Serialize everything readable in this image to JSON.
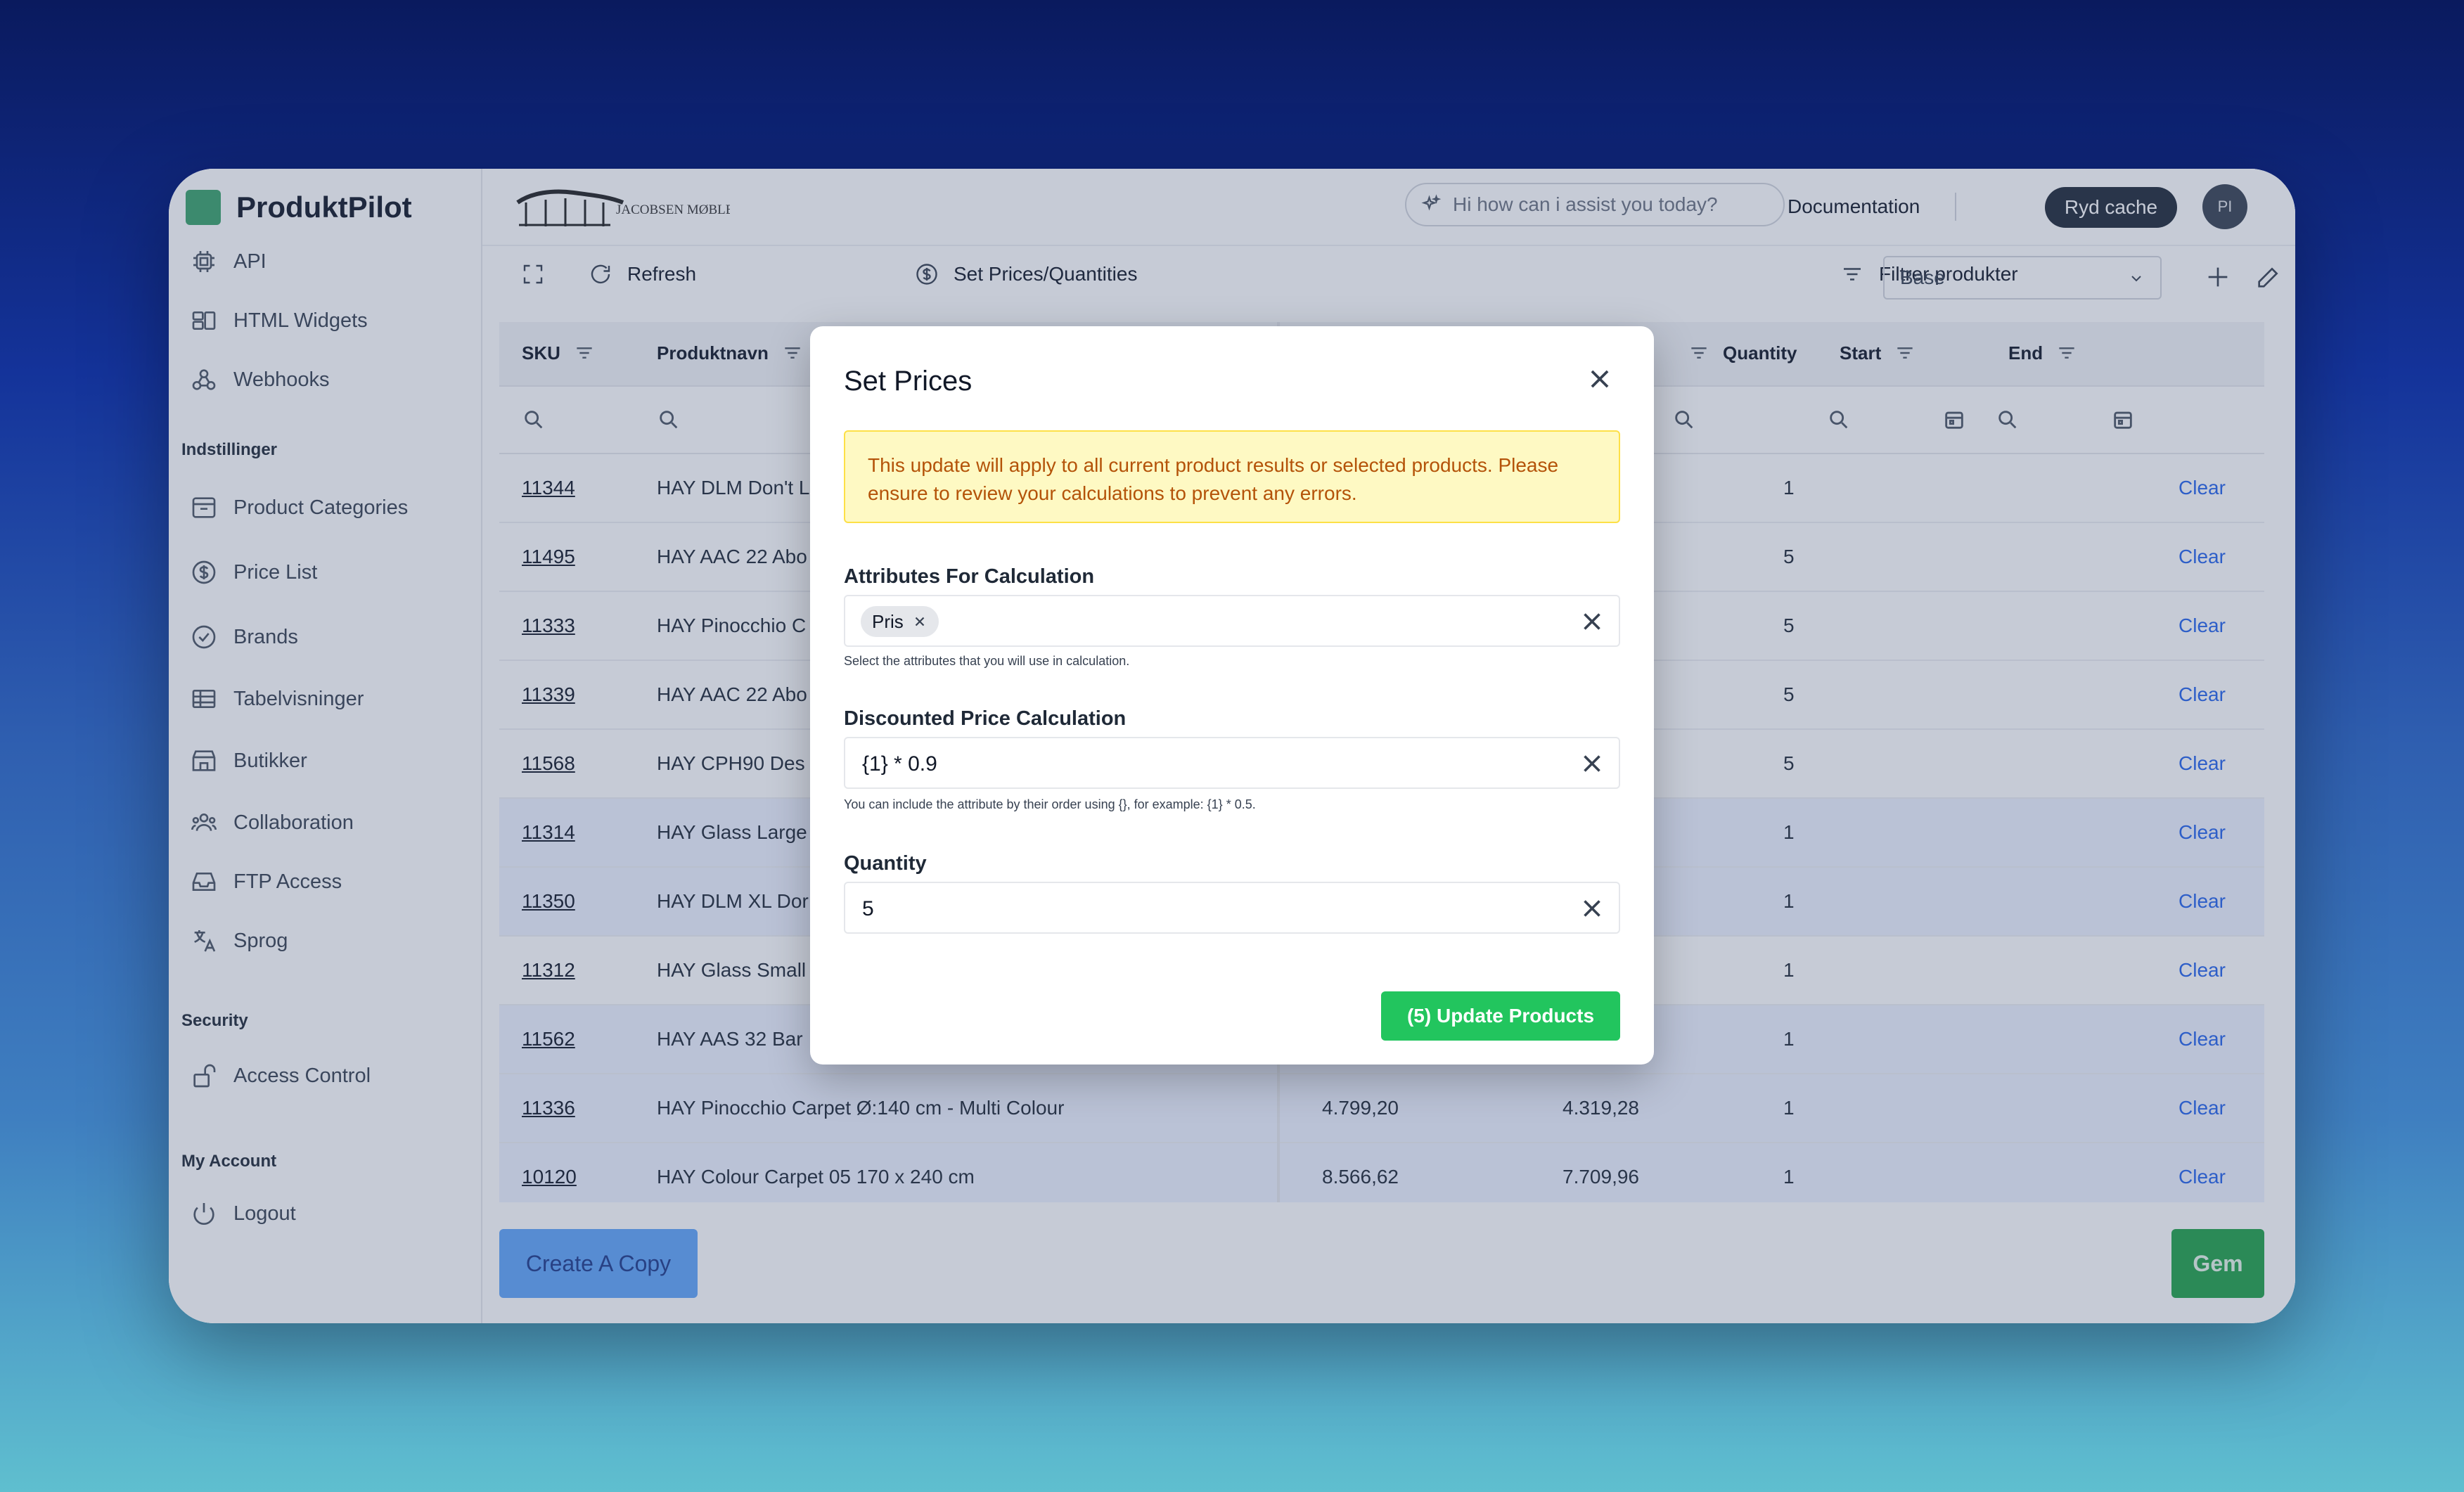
{
  "app": {
    "name": "ProduktPilot"
  },
  "sidebar": {
    "top_items": [
      {
        "label": "API",
        "icon": "chip-icon"
      },
      {
        "label": "HTML Widgets",
        "icon": "widgets-icon"
      },
      {
        "label": "Webhooks",
        "icon": "webhook-icon"
      }
    ],
    "section_settings": "Indstillinger",
    "settings_items": [
      {
        "label": "Product Categories",
        "icon": "archive-icon"
      },
      {
        "label": "Price List",
        "icon": "dollar-icon"
      },
      {
        "label": "Brands",
        "icon": "check-badge-icon"
      },
      {
        "label": "Tabelvisninger",
        "icon": "table-icon"
      },
      {
        "label": "Butikker",
        "icon": "store-icon"
      },
      {
        "label": "Collaboration",
        "icon": "users-icon"
      },
      {
        "label": "FTP Access",
        "icon": "inbox-icon"
      },
      {
        "label": "Sprog",
        "icon": "language-icon"
      }
    ],
    "section_security": "Security",
    "security_items": [
      {
        "label": "Access Control",
        "icon": "lock-icon"
      }
    ],
    "section_account": "My Account",
    "account_items": [
      {
        "label": "Logout",
        "icon": "power-icon"
      }
    ]
  },
  "header": {
    "ask_placeholder": "Hi how can i assist you today?",
    "documentation": "Documentation",
    "ryd_cache": "Ryd cache",
    "avatar": "PI"
  },
  "toolbar": {
    "refresh": "Refresh",
    "set_prices": "Set Prices/Quantities",
    "filter": "Filtrer produkter",
    "view_select": "Base"
  },
  "table": {
    "columns": [
      "SKU",
      "Produktnavn",
      "Quantity",
      "Start",
      "End"
    ],
    "rows": [
      {
        "sku": "11344",
        "name": "HAY DLM Don't L",
        "p1": "",
        "p2": "",
        "qty": "1",
        "action": "Clear",
        "selected": false
      },
      {
        "sku": "11495",
        "name": "HAY AAC 22 Abo",
        "p1": "",
        "p2": "",
        "qty": "5",
        "action": "Clear",
        "selected": false
      },
      {
        "sku": "11333",
        "name": "HAY Pinocchio C",
        "p1": "",
        "p2": "",
        "qty": "5",
        "action": "Clear",
        "selected": false
      },
      {
        "sku": "11339",
        "name": "HAY AAC 22 Abo",
        "p1": "",
        "p2": "",
        "qty": "5",
        "action": "Clear",
        "selected": false
      },
      {
        "sku": "11568",
        "name": "HAY CPH90 Des",
        "p1": "",
        "p2": "",
        "qty": "5",
        "action": "Clear",
        "selected": false
      },
      {
        "sku": "11314",
        "name": "HAY Glass Large",
        "p1": "",
        "p2": "",
        "qty": "1",
        "action": "Clear",
        "selected": true
      },
      {
        "sku": "11350",
        "name": "HAY DLM XL Dor",
        "p1": "",
        "p2": "",
        "qty": "1",
        "action": "Clear",
        "selected": true
      },
      {
        "sku": "11312",
        "name": "HAY Glass Small",
        "p1": "",
        "p2": "",
        "qty": "1",
        "action": "Clear",
        "selected": false
      },
      {
        "sku": "11562",
        "name": "HAY AAS 32 Bar",
        "p1": "",
        "p2": "",
        "qty": "1",
        "action": "Clear",
        "selected": true
      },
      {
        "sku": "11336",
        "name": "HAY Pinocchio Carpet Ø:140 cm - Multi Colour",
        "p1": "4.799,20",
        "p2": "4.319,28",
        "qty": "1",
        "action": "Clear",
        "selected": true
      },
      {
        "sku": "10120",
        "name": "HAY Colour Carpet 05 170 x 240 cm",
        "p1": "8.566,62",
        "p2": "7.709,96",
        "qty": "1",
        "action": "Clear",
        "selected": true
      }
    ]
  },
  "footer": {
    "create_copy": "Create A Copy",
    "save": "Gem"
  },
  "modal": {
    "title": "Set Prices",
    "warning": "This update will apply to all current product results or selected products. Please ensure to review your calculations to prevent any errors.",
    "attributes_label": "Attributes For Calculation",
    "attribute_chip": "Pris",
    "attributes_hint": "Select the attributes that you will use in calculation.",
    "discount_label": "Discounted Price Calculation",
    "discount_value": "{1} * 0.9",
    "discount_hint": "You can include the attribute by their order using {}, for example: {1} * 0.5.",
    "quantity_label": "Quantity",
    "quantity_value": "5",
    "update_button": "(5) Update Products"
  },
  "colors": {
    "brand": "#3aa26a",
    "link": "#2563eb",
    "warning_bg": "#fef9c3",
    "primary": "#22c55e"
  }
}
